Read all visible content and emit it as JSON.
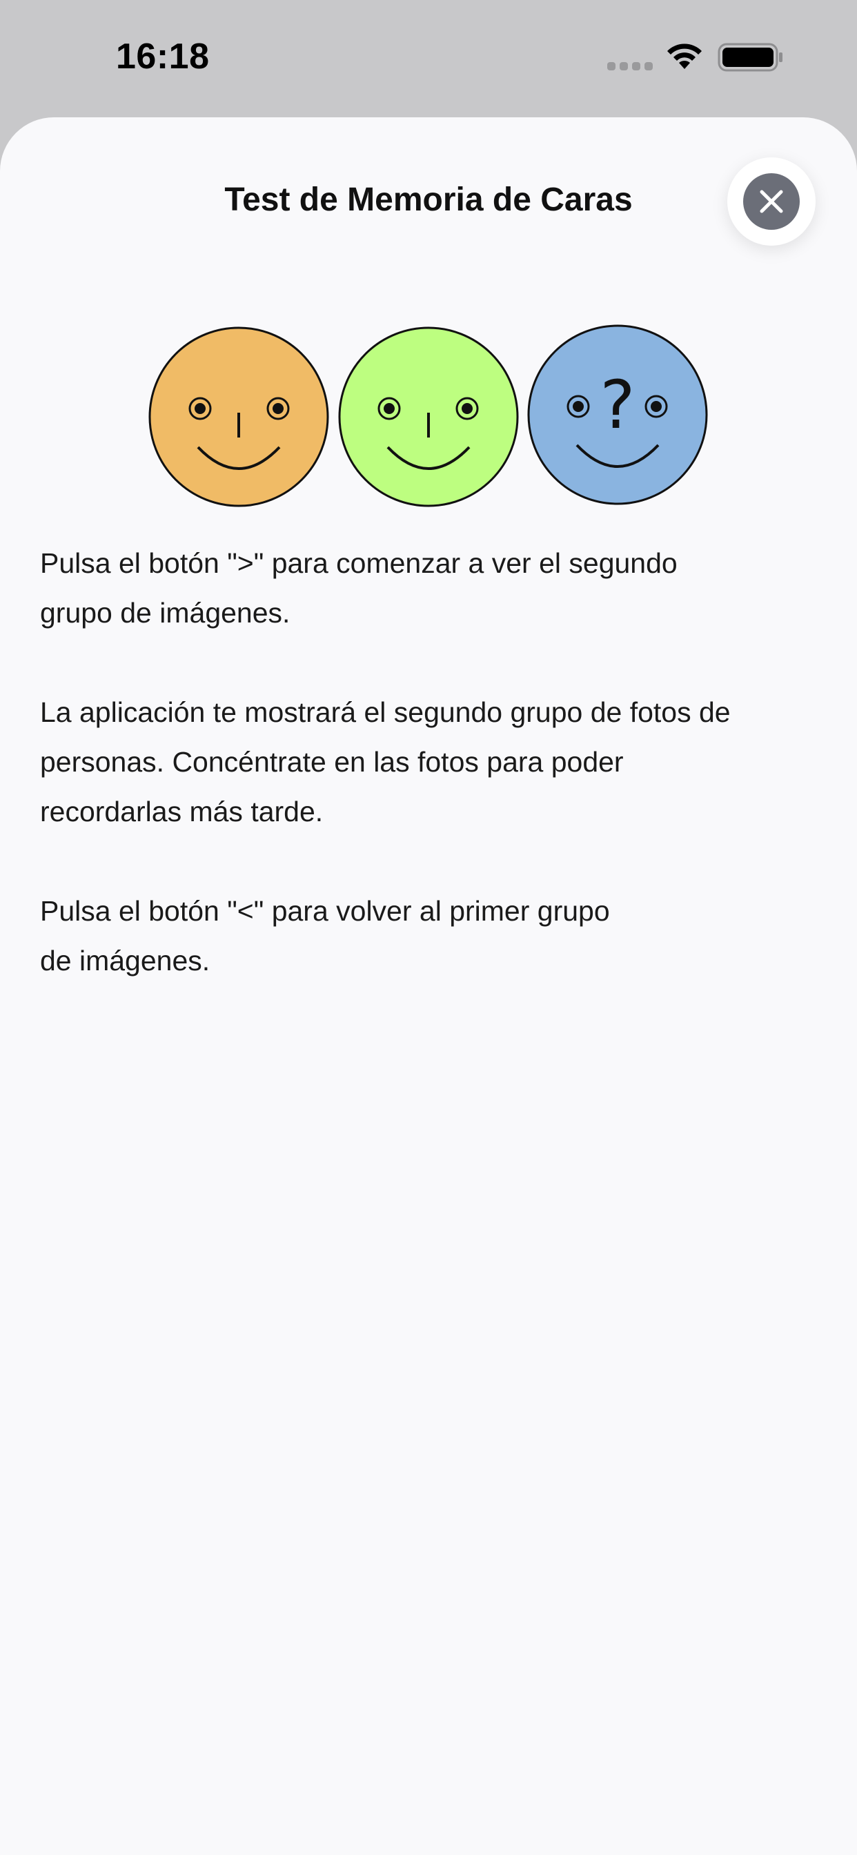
{
  "status_bar": {
    "time": "16:18",
    "icons": [
      "cellular-signal-icon",
      "wifi-icon",
      "battery-icon"
    ]
  },
  "sheet": {
    "title": "Test de Memoria de Caras",
    "close_icon": "close-icon"
  },
  "illustration": {
    "faces": [
      {
        "name": "orange-face",
        "color": "#f0bb66"
      },
      {
        "name": "green-face",
        "color": "#bdfe80"
      },
      {
        "name": "blue-face",
        "color": "#8ab4e0",
        "mark": "?"
      }
    ]
  },
  "instructions": [
    "Pulsa el botón \">\" para comenzar a ver el segundo\ngrupo de imágenes.",
    "La aplicación te mostrará el segundo grupo de fotos de\npersonas. Concéntrate en las fotos para poder\nrecordarlas más tarde.",
    "Pulsa el botón \"<\" para volver al primer grupo\nde imágenes."
  ]
}
